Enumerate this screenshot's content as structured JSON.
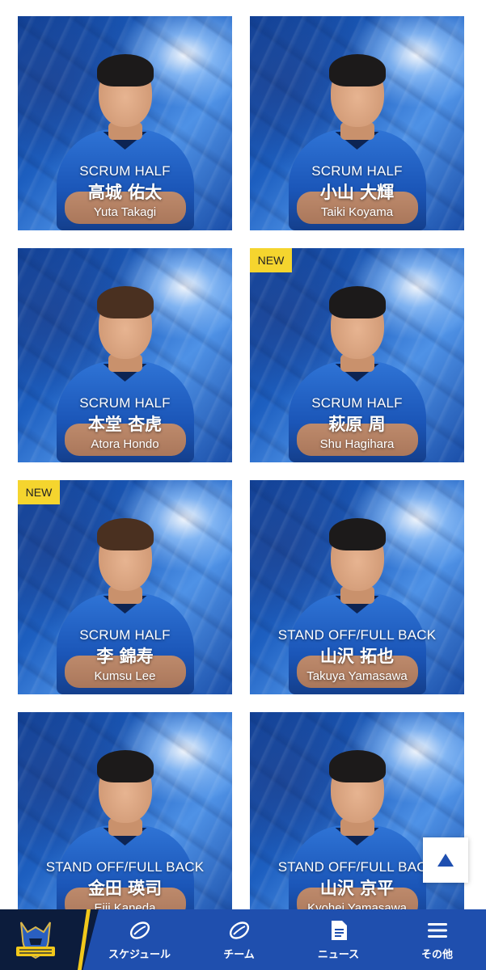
{
  "players": [
    {
      "position": "SCRUM HALF",
      "name_ja": "高城 佑太",
      "name_en": "Yuta Takagi",
      "is_new": false
    },
    {
      "position": "SCRUM HALF",
      "name_ja": "小山 大輝",
      "name_en": "Taiki Koyama",
      "is_new": false
    },
    {
      "position": "SCRUM HALF",
      "name_ja": "本堂 杏虎",
      "name_en": "Atora Hondo",
      "is_new": false
    },
    {
      "position": "SCRUM HALF",
      "name_ja": "萩原 周",
      "name_en": "Shu Hagihara",
      "is_new": true
    },
    {
      "position": "SCRUM HALF",
      "name_ja": "李 錦寿",
      "name_en": "Kumsu Lee",
      "is_new": true
    },
    {
      "position": "STAND OFF/FULL BACK",
      "name_ja": "山沢 拓也",
      "name_en": "Takuya Yamasawa",
      "is_new": false
    },
    {
      "position": "STAND OFF/FULL BACK",
      "name_ja": "金田 瑛司",
      "name_en": "Eiji Kaneda",
      "is_new": false
    },
    {
      "position": "STAND OFF/FULL BACK",
      "name_ja": "山沢 京平",
      "name_en": "Kyohei Yamasawa",
      "is_new": false
    }
  ],
  "badge": {
    "new_label": "NEW"
  },
  "scroll_top": {
    "icon": "triangle-up-icon"
  },
  "logo": {
    "text": "WILD KNIGHTS"
  },
  "nav": {
    "items": [
      {
        "label": "スケジュール",
        "icon": "rugby-ball-icon"
      },
      {
        "label": "チーム",
        "icon": "rugby-ball-icon"
      },
      {
        "label": "ニュース",
        "icon": "document-icon"
      },
      {
        "label": "その他",
        "icon": "hamburger-menu-icon"
      }
    ]
  },
  "colors": {
    "nav_bg": "#1f4fae",
    "logo_bg": "#0c1c3c",
    "accent_yellow": "#f2c81b",
    "badge_yellow": "#f5d52e",
    "card_blue": "#1d5fc0"
  }
}
